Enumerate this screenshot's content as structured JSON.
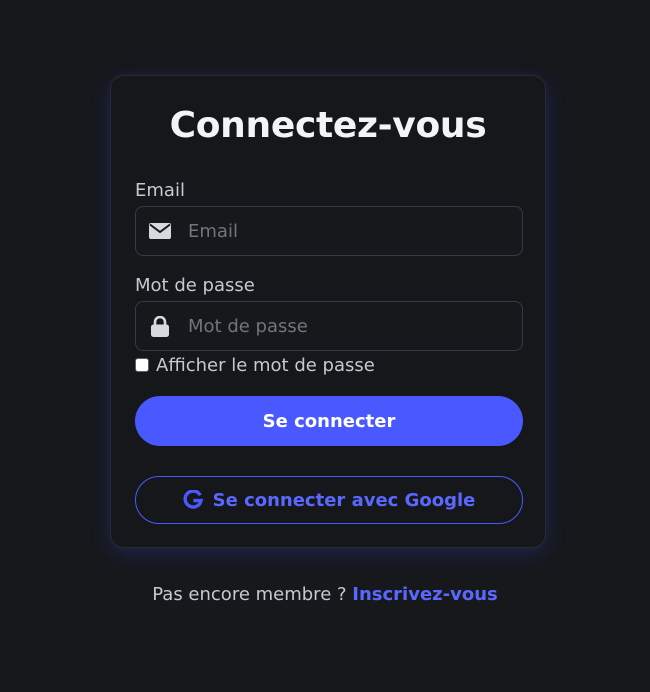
{
  "login": {
    "title": "Connectez-vous",
    "email_label": "Email",
    "email_placeholder": "Email",
    "email_icon": "envelope-icon",
    "password_label": "Mot de passe",
    "password_placeholder": "Mot de passe",
    "password_icon": "lock-icon",
    "show_password_label": "Afficher le mot de passe",
    "show_password_checked": false,
    "submit_label": "Se connecter",
    "google_label": "Se connecter avec Google",
    "google_icon": "google-icon"
  },
  "signup": {
    "prompt": "Pas encore membre ?",
    "link_label": "Inscrivez-vous"
  },
  "colors": {
    "background": "#16181c",
    "card": "#15171b",
    "accent": "#4a59ff",
    "text": "#c6c9d0",
    "title": "#f3f4f6"
  }
}
